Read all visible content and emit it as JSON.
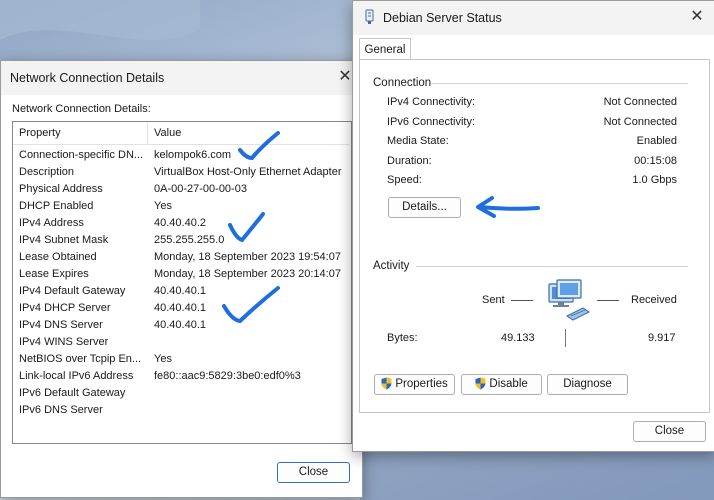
{
  "network_details": {
    "title": "Network Connection Details",
    "section_label": "Network Connection Details:",
    "columns": [
      "Property",
      "Value"
    ],
    "rows": [
      {
        "property": "Connection-specific DN...",
        "value": "kelompok6.com"
      },
      {
        "property": "Description",
        "value": "VirtualBox Host-Only Ethernet Adapter"
      },
      {
        "property": "Physical Address",
        "value": "0A-00-27-00-00-03"
      },
      {
        "property": "DHCP Enabled",
        "value": "Yes"
      },
      {
        "property": "IPv4 Address",
        "value": "40.40.40.2"
      },
      {
        "property": "IPv4 Subnet Mask",
        "value": "255.255.255.0"
      },
      {
        "property": "Lease Obtained",
        "value": "Monday, 18 September 2023 19:54:07"
      },
      {
        "property": "Lease Expires",
        "value": "Monday, 18 September 2023 20:14:07"
      },
      {
        "property": "IPv4 Default Gateway",
        "value": "40.40.40.1"
      },
      {
        "property": "IPv4 DHCP Server",
        "value": "40.40.40.1"
      },
      {
        "property": "IPv4 DNS Server",
        "value": "40.40.40.1"
      },
      {
        "property": "IPv4 WINS Server",
        "value": ""
      },
      {
        "property": "NetBIOS over Tcpip En...",
        "value": "Yes"
      },
      {
        "property": "Link-local IPv6 Address",
        "value": "fe80::aac9:5829:3be0:edf0%3"
      },
      {
        "property": "IPv6 Default Gateway",
        "value": ""
      },
      {
        "property": "IPv6 DNS Server",
        "value": ""
      }
    ],
    "close_label": "Close"
  },
  "status_window": {
    "title": "Debian Server Status",
    "tab_general": "General",
    "connection": {
      "heading": "Connection",
      "ipv4_label": "IPv4 Connectivity:",
      "ipv4_value": "Not Connected",
      "ipv6_label": "IPv6 Connectivity:",
      "ipv6_value": "Not Connected",
      "media_label": "Media State:",
      "media_value": "Enabled",
      "duration_label": "Duration:",
      "duration_value": "00:15:08",
      "speed_label": "Speed:",
      "speed_value": "1.0 Gbps",
      "details_button": "Details..."
    },
    "activity": {
      "heading": "Activity",
      "sent_label": "Sent",
      "received_label": "Received",
      "bytes_label": "Bytes:",
      "bytes_sent": "49.133",
      "bytes_received": "9.917"
    },
    "buttons": {
      "properties": "Properties",
      "disable": "Disable",
      "diagnose": "Diagnose",
      "close": "Close"
    }
  },
  "colors": {
    "annotation_blue": "#1f6ee0",
    "shield_blue": "#2b63c9",
    "shield_yellow": "#f2c21b"
  }
}
